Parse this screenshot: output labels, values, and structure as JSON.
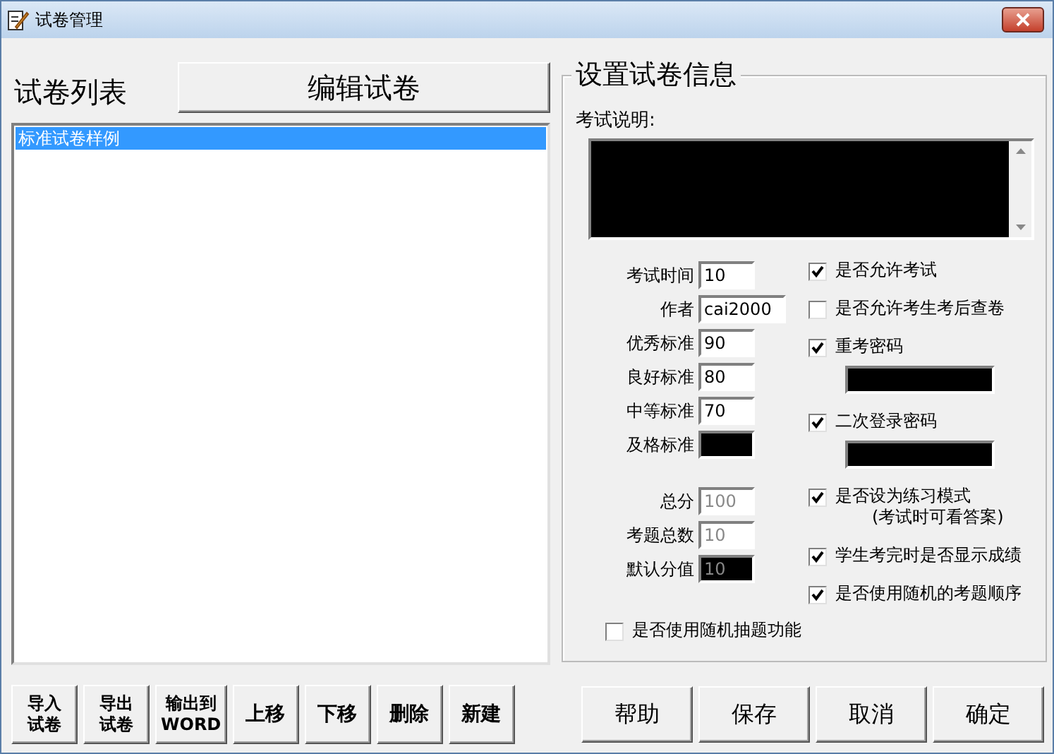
{
  "window": {
    "title": "试卷管理"
  },
  "list_panel": {
    "title": "试卷列表",
    "edit_button": "编辑试卷",
    "items": [
      {
        "label": "标准试卷样例",
        "selected": true
      }
    ]
  },
  "settings": {
    "title": "设置试卷信息",
    "description_label": "考试说明:",
    "fields": [
      {
        "label": "考试时间",
        "value": "10",
        "disabled": false,
        "dark": false,
        "wide": false
      },
      {
        "label": "作者",
        "value": "cai2000",
        "disabled": false,
        "dark": false,
        "wide": true
      },
      {
        "label": "优秀标准",
        "value": "90",
        "disabled": false,
        "dark": false,
        "wide": false
      },
      {
        "label": "良好标准",
        "value": "80",
        "disabled": false,
        "dark": false,
        "wide": false
      },
      {
        "label": "中等标准",
        "value": "70",
        "disabled": false,
        "dark": false,
        "wide": false
      },
      {
        "label": "及格标准",
        "disabled": false,
        "dark": true,
        "wide": false
      }
    ],
    "totals": [
      {
        "label": "总分",
        "value": "100",
        "disabled": true,
        "dark": false
      },
      {
        "label": "考题总数",
        "value": "10",
        "disabled": true,
        "dark": false
      },
      {
        "label": "默认分值",
        "value": "10",
        "disabled": true,
        "dark": true
      }
    ],
    "options": [
      {
        "kind": "checkbox",
        "label": "是否允许考试",
        "checked": true
      },
      {
        "kind": "checkbox",
        "label": "是否允许考生考后查卷",
        "checked": false
      },
      {
        "kind": "password",
        "label": "重考密码",
        "checked": true
      },
      {
        "kind": "password",
        "label": "二次登录密码",
        "checked": true
      },
      {
        "kind": "checkbox",
        "label": "是否设为练习模式",
        "note": "(考试时可看答案)",
        "checked": true
      },
      {
        "kind": "checkbox",
        "label": "学生考完时是否显示成绩",
        "checked": true
      },
      {
        "kind": "checkbox",
        "label": "是否使用随机的考题顺序",
        "checked": true
      }
    ],
    "random_option": {
      "label": "是否使用随机抽题功能",
      "checked": false
    }
  },
  "left_buttons": [
    {
      "lines": [
        "导入",
        "试卷"
      ]
    },
    {
      "lines": [
        "导出",
        "试卷"
      ]
    },
    {
      "lines": [
        "输出到",
        "WORD"
      ]
    },
    {
      "lines": [
        "上移"
      ]
    },
    {
      "lines": [
        "下移"
      ]
    },
    {
      "lines": [
        "删除"
      ]
    },
    {
      "lines": [
        "新建"
      ]
    }
  ],
  "right_buttons": [
    "帮助",
    "保存",
    "取消",
    "确定"
  ]
}
